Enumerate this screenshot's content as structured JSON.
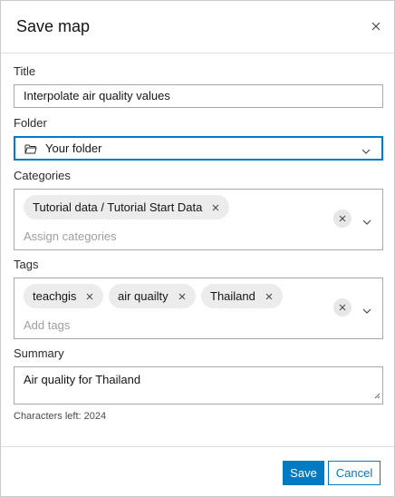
{
  "dialog": {
    "title": "Save map",
    "close_icon": "close-icon"
  },
  "title_field": {
    "label": "Title",
    "value": "Interpolate air quality values"
  },
  "folder_field": {
    "label": "Folder",
    "value": "Your folder",
    "icon": "folder-icon"
  },
  "categories_field": {
    "label": "Categories",
    "chips": [
      "Tutorial data / Tutorial Start Data"
    ],
    "placeholder": "Assign categories"
  },
  "tags_field": {
    "label": "Tags",
    "chips": [
      "teachgis",
      "air quailty",
      "Thailand"
    ],
    "placeholder": "Add tags"
  },
  "summary_field": {
    "label": "Summary",
    "value": "Air quality for Thailand",
    "characters_left": "Characters left: 2024"
  },
  "actions": {
    "save_label": "Save",
    "cancel_label": "Cancel"
  },
  "colors": {
    "accent": "#007ac2",
    "border": "#a8a8a8",
    "chip_bg": "#ececec"
  }
}
